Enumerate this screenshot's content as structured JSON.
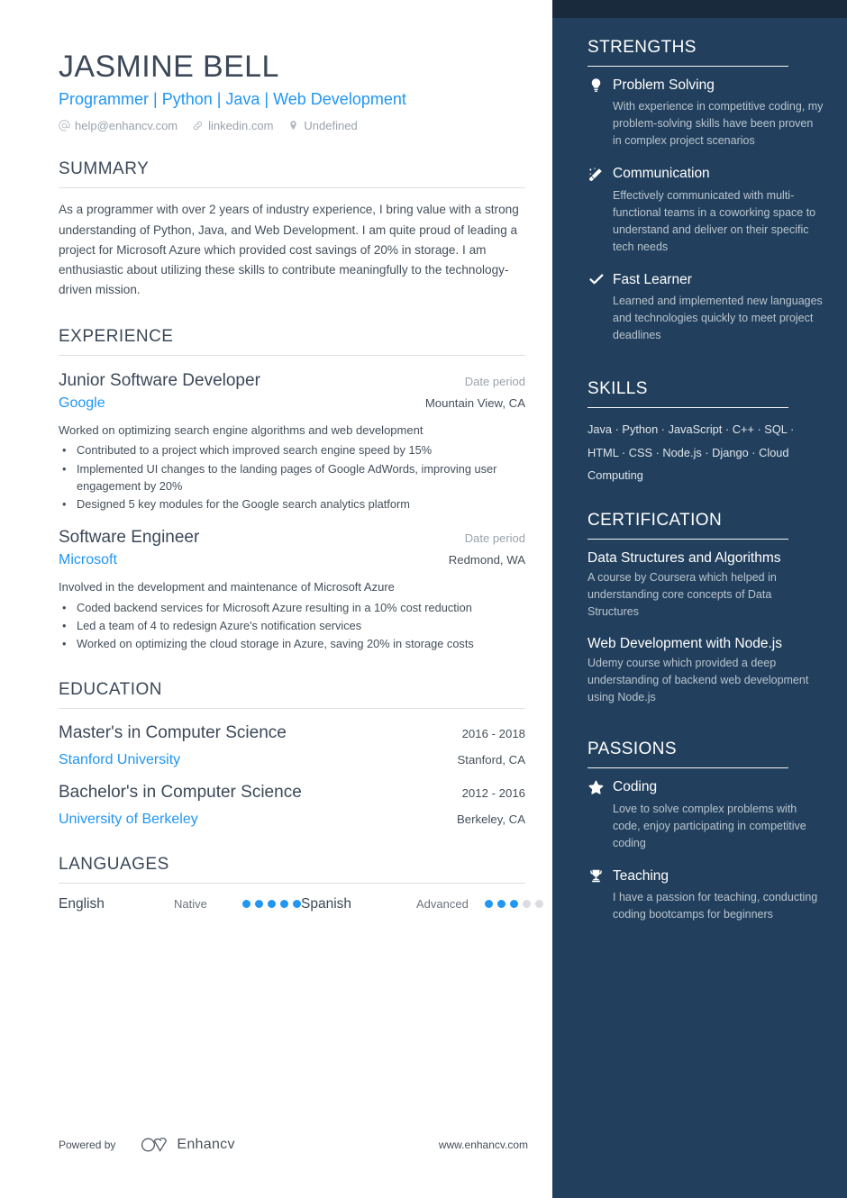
{
  "header": {
    "name": "JASMINE BELL",
    "headline": "Programmer | Python | Java | Web Development",
    "contacts": [
      {
        "icon": "at-icon",
        "text": "help@enhancv.com"
      },
      {
        "icon": "link-icon",
        "text": "linkedin.com"
      },
      {
        "icon": "location-pin-icon",
        "text": "Undefined"
      }
    ]
  },
  "summary": {
    "heading": "SUMMARY",
    "text": "As a programmer with over 2 years of industry experience, I bring value with a strong understanding of Python, Java, and Web Development. I am quite proud of leading a project for Microsoft Azure which provided cost savings of 20% in storage. I am enthusiastic about utilizing these skills to contribute meaningfully to the technology-driven mission."
  },
  "experience": {
    "heading": "EXPERIENCE",
    "entries": [
      {
        "title": "Junior Software Developer",
        "date": "Date period",
        "organization": "Google",
        "location": "Mountain View, CA",
        "description": "Worked on optimizing search engine algorithms and web development",
        "bullets": [
          "Contributed to a project which improved search engine speed by 15%",
          "Implemented UI changes to the landing pages of Google AdWords, improving user engagement by 20%",
          "Designed 5 key modules for the Google search analytics platform"
        ]
      },
      {
        "title": "Software Engineer",
        "date": "Date period",
        "organization": "Microsoft",
        "location": "Redmond, WA",
        "description": "Involved in the development and maintenance of Microsoft Azure",
        "bullets": [
          "Coded backend services for Microsoft Azure resulting in a 10% cost reduction",
          "Led a team of 4 to redesign Azure's notification services",
          "Worked on optimizing the cloud storage in Azure, saving 20% in storage costs"
        ]
      }
    ]
  },
  "education": {
    "heading": "EDUCATION",
    "entries": [
      {
        "degree": "Master's in Computer Science",
        "date": "2016 - 2018",
        "school": "Stanford University",
        "location": "Stanford, CA"
      },
      {
        "degree": "Bachelor's in Computer Science",
        "date": "2012 - 2016",
        "school": "University of Berkeley",
        "location": "Berkeley, CA"
      }
    ]
  },
  "languages": {
    "heading": "LANGUAGES",
    "items": [
      {
        "name": "English",
        "level": "Native",
        "filled": 5,
        "total": 5
      },
      {
        "name": "Spanish",
        "level": "Advanced",
        "filled": 3,
        "total": 5
      }
    ]
  },
  "strengths": {
    "heading": "STRENGTHS",
    "items": [
      {
        "icon": "lightbulb-icon",
        "title": "Problem Solving",
        "description": "With experience in competitive coding, my problem-solving skills have been proven in complex project scenarios"
      },
      {
        "icon": "magic-wand-icon",
        "title": "Communication",
        "description": "Effectively communicated with multi-functional teams in a coworking space to understand and deliver on their specific tech needs"
      },
      {
        "icon": "check-icon",
        "title": "Fast Learner",
        "description": "Learned and implemented new languages and technologies quickly to meet project deadlines"
      }
    ]
  },
  "skills": {
    "heading": "SKILLS",
    "items": [
      "Java",
      "Python",
      "JavaScript",
      "C++",
      "SQL",
      "HTML",
      "CSS",
      "Node.js",
      "Django",
      "Cloud Computing"
    ],
    "text": "Java · Python · JavaScript · C++ · SQL · HTML · CSS · Node.js · Django · Cloud Computing"
  },
  "certification": {
    "heading": "CERTIFICATION",
    "items": [
      {
        "title": "Data Structures and Algorithms",
        "description": "A course by Coursera which helped in understanding core concepts of Data Structures"
      },
      {
        "title": "Web Development with Node.js",
        "description": "Udemy course which provided a deep understanding of backend web development using Node.js"
      }
    ]
  },
  "passions": {
    "heading": "PASSIONS",
    "items": [
      {
        "icon": "star-icon",
        "title": "Coding",
        "description": "Love to solve complex problems with code, enjoy participating in competitive coding"
      },
      {
        "icon": "trophy-icon",
        "title": "Teaching",
        "description": "I have a passion for teaching, conducting coding bootcamps for beginners"
      }
    ]
  },
  "footer": {
    "powered_by": "Powered by",
    "brand": "Enhancv",
    "website": "www.enhancv.com"
  },
  "colors": {
    "sidebar_bg": "#22405d",
    "sidebar_cap": "#1a2a3d",
    "accent_blue": "#2196f3",
    "heading_dark": "#3c4858",
    "body_text": "#454f5b",
    "muted": "#9aa2ab",
    "dot_off": "#dadce0"
  }
}
